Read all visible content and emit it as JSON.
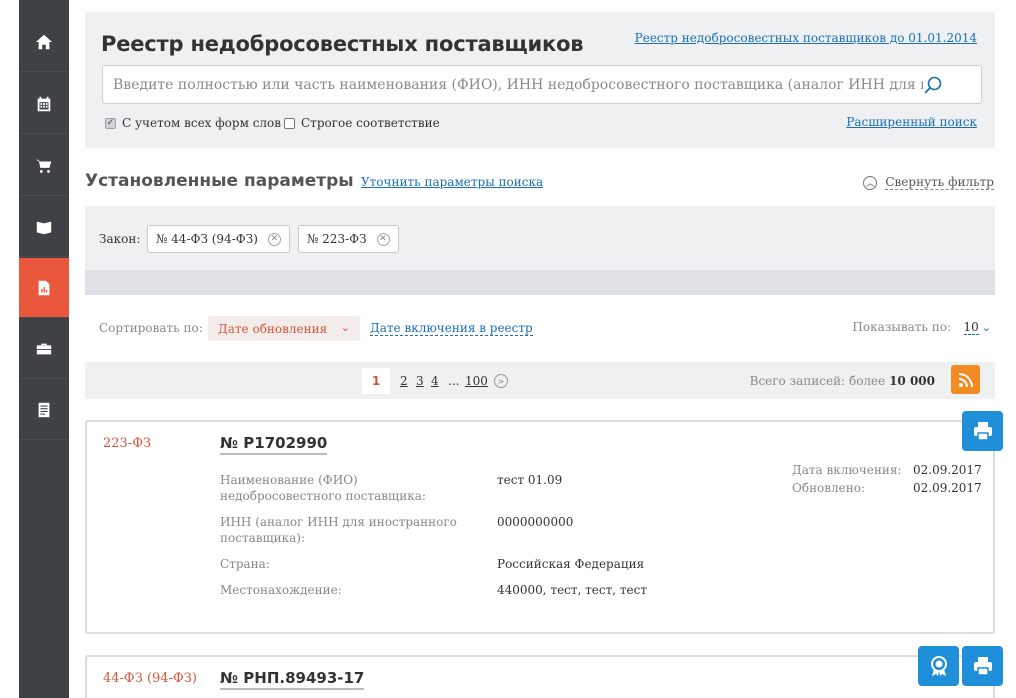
{
  "sidebar": {
    "items": [
      {
        "icon": "home-icon",
        "active": false
      },
      {
        "icon": "calendar-icon",
        "active": false
      },
      {
        "icon": "cart-icon",
        "active": false
      },
      {
        "icon": "book-icon",
        "active": false
      },
      {
        "icon": "report-icon",
        "active": true
      },
      {
        "icon": "briefcase-icon",
        "active": false
      },
      {
        "icon": "document-icon",
        "active": false
      }
    ]
  },
  "search": {
    "title": "Реестр недобросовестных поставщиков",
    "old_registry_link": "Реестр недобросовестных поставщиков до 01.01.2014",
    "placeholder": "Введите полностью или часть наименования (ФИО), ИНН недобросовестного поставщика (аналог ИНН для иностр",
    "checkbox_all_forms": "С учетом всех форм слов",
    "checkbox_strict": "Строгое соответствие",
    "advanced_link": "Расширенный поиск"
  },
  "params": {
    "title": "Установленные параметры",
    "refine_link": "Уточнить параметры поиска",
    "collapse": "Свернуть фильтр",
    "law_label": "Закон:",
    "chips": [
      "№ 44-ФЗ (94-ФЗ)",
      "№ 223-ФЗ"
    ]
  },
  "sort": {
    "label": "Сортировать по:",
    "selected": "Дате обновления",
    "alternative": "Дате включения в реестр",
    "show_label": "Показывать по:",
    "show_value": "10"
  },
  "pager": {
    "current": "1",
    "pages": [
      "2",
      "3",
      "4"
    ],
    "dots": "...",
    "last": "100",
    "total_label": "Всего записей: более ",
    "total_value": "10 000"
  },
  "records": [
    {
      "law": "223-ФЗ",
      "number": "№ Р1702990",
      "fields": [
        {
          "label": "Наименование (ФИО) недобросовестного поставщика:",
          "value": "тест 01.09"
        },
        {
          "label": "ИНН (аналог ИНН для иностранного поставщика):",
          "value": "0000000000"
        },
        {
          "label": "Страна:",
          "value": "Российская Федерация"
        },
        {
          "label": "Местонахождение:",
          "value": "440000, тест, тест, тест"
        }
      ],
      "included_label": "Дата включения:",
      "included_value": "02.09.2017",
      "updated_label": "Обновлено:",
      "updated_value": "02.09.2017"
    },
    {
      "law": "44-ФЗ (94-ФЗ)",
      "number": "№ РНП.89493-17"
    }
  ],
  "colors": {
    "accent": "#e8573b",
    "link": "#1a6fb5",
    "sidebar": "#3e4145",
    "float_button": "#1e8fd8",
    "rss": "#f28b22"
  }
}
